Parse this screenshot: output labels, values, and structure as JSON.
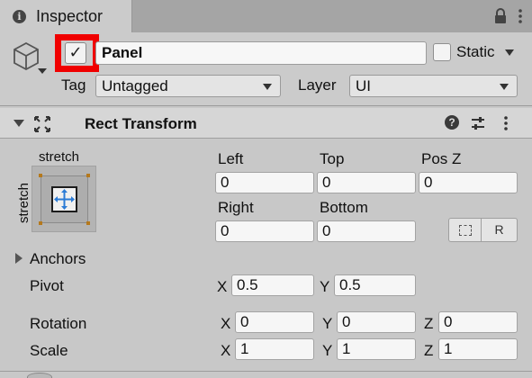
{
  "window": {
    "tab_label": "Inspector",
    "tab_icon": "info-icon",
    "lock_icon": "lock-icon",
    "menu_icon": "kebab-menu-icon"
  },
  "gameobject": {
    "icon": "cube-icon",
    "active_checkbox": "✓",
    "active": true,
    "name": "Panel",
    "static_label": "Static",
    "static": false,
    "tag_label": "Tag",
    "tag_value": "Untagged",
    "layer_label": "Layer",
    "layer_value": "UI",
    "highlight_color": "#f00000"
  },
  "component": {
    "title": "Rect Transform",
    "expanded": true,
    "icons": [
      "rect-tool-icon",
      "help-icon",
      "presets-icon",
      "kebab-menu-icon"
    ]
  },
  "anchor_preset": {
    "horizontal": "stretch",
    "vertical": "stretch"
  },
  "rect": {
    "left_label": "Left",
    "left": "0",
    "top_label": "Top",
    "top": "0",
    "posz_label": "Pos Z",
    "posz": "0",
    "right_label": "Right",
    "right": "0",
    "bottom_label": "Bottom",
    "bottom": "0",
    "raw_button": "R"
  },
  "anchors": {
    "label": "Anchors",
    "expanded": false
  },
  "pivot": {
    "label": "Pivot",
    "x_label": "X",
    "x": "0.5",
    "y_label": "Y",
    "y": "0.5"
  },
  "rotation": {
    "label": "Rotation",
    "x_label": "X",
    "x": "0",
    "y_label": "Y",
    "y": "0",
    "z_label": "Z",
    "z": "0"
  },
  "scale": {
    "label": "Scale",
    "x_label": "X",
    "x": "1",
    "y_label": "Y",
    "y": "1",
    "z_label": "Z",
    "z": "1"
  }
}
